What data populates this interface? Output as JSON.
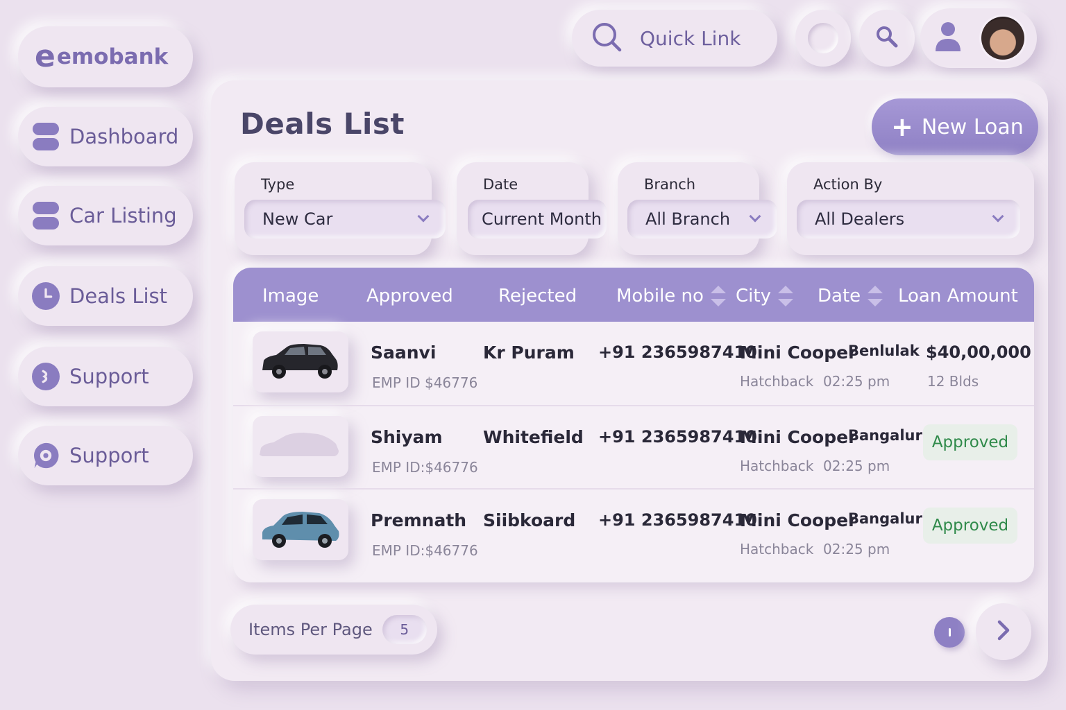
{
  "brand": {
    "logo_mark": "e",
    "logo_text": "emobank"
  },
  "sidebar": {
    "items": [
      {
        "label": "Dashboard",
        "icon": "stack-icon"
      },
      {
        "label": "Car Listing",
        "icon": "stack-icon"
      },
      {
        "label": "Deals List",
        "icon": "clock-icon"
      },
      {
        "label": "Support",
        "icon": "support-icon"
      },
      {
        "label": "Support",
        "icon": "settings-chat-icon"
      }
    ]
  },
  "topbar": {
    "quick_link": "Quick Link"
  },
  "page": {
    "title": "Deals List",
    "new_loan": "New Loan"
  },
  "filters": [
    {
      "label": "Type",
      "value": "New Car"
    },
    {
      "label": "Date",
      "value": "Current Month"
    },
    {
      "label": "Branch",
      "value": "All Branch"
    },
    {
      "label": "Action By",
      "value": "All Dealers"
    }
  ],
  "table": {
    "headers": [
      "Image",
      "Approved",
      "Rejected",
      "Mobile no",
      "City",
      "Date",
      "Loan Amount"
    ],
    "rows": [
      {
        "name": "Saanvi",
        "emp": "EMP ID $46776",
        "location": "Kr Puram",
        "mobile": "+91 2365987410",
        "car": "Mini Cooper",
        "car_type": "Hatchback",
        "city": "Benlulak",
        "time": "02:25 pm",
        "amount": "$40,00,000",
        "bids": "12 Blds",
        "image": "black-suv"
      },
      {
        "name": "Shiyam",
        "emp": "EMP ID:$46776",
        "location": "Whitefield",
        "mobile": "+91 2365987410",
        "car": "Mini Cooper",
        "car_type": "Hatchback",
        "city": "Bangaluru",
        "time": "02:25 pm",
        "status": "Approved",
        "image": "faded-car"
      },
      {
        "name": "Premnath",
        "emp": "EMP ID:$46776",
        "location": "Siibkoard",
        "mobile": "+91 2365987410",
        "car": "Mini Cooper",
        "car_type": "Hatchback",
        "city": "Bangaluru",
        "time": "02:25 pm",
        "status": "Approved",
        "image": "blue-hatchback"
      }
    ]
  },
  "footer": {
    "items_per_page_label": "Items Per Page",
    "items_per_page_value": "5"
  },
  "colors": {
    "accent": "#8e80c4",
    "background": "#ebe1ee",
    "header": "#9d90cf",
    "approved": "#2f8a4a"
  }
}
